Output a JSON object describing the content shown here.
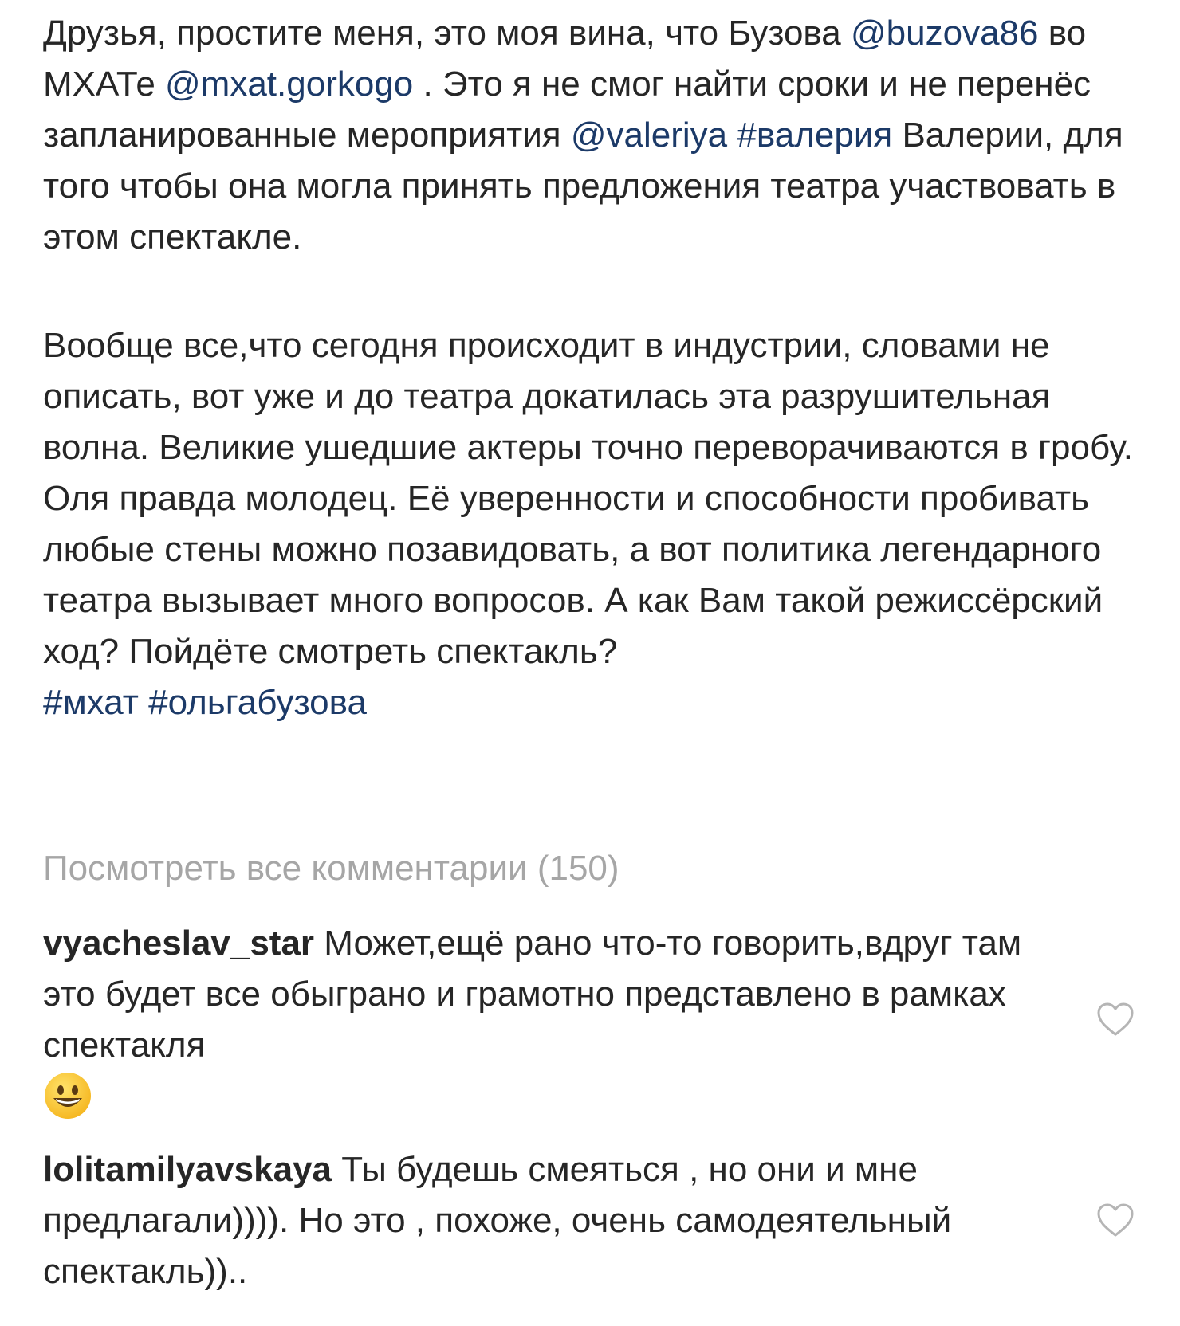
{
  "caption": {
    "clipped_top_line": "…",
    "para1": {
      "t1": "Друзья, простите меня, это моя вина, что Бузова ",
      "mention1": "@buzova86",
      "t2": " во МХАТе ",
      "mention2": "@mxat.gorkogo",
      "t3": " . Это я не смог найти сроки и не перенёс запланированные мероприятия ",
      "mention3": "@valeriya",
      "t4": " ",
      "hashtag1": "#валерия",
      "t5": " Валерии, для того чтобы она могла  принять предложения театра участвовать в этом спектакле."
    },
    "para2": {
      "text": "Вообще все,что сегодня происходит в индустрии, словами не описать, вот уже и до театра докатилась эта разрушительная волна. Великие ушедшие актеры точно переворачиваются в гробу. Оля правда молодец. Её уверенности и способности пробивать любые стены можно позавидовать, а вот политика легендарного театра вызывает много вопросов. А как Вам такой режиссёрский ход? Пойдёте смотреть спектакль?",
      "hashtag1": "#мхат",
      "hashtag2": "#ольгабузова"
    }
  },
  "view_all_comments": "Посмотреть все комментарии (150)",
  "comments": [
    {
      "username": "vyacheslav_star",
      "text": "Может,ещё рано что-то говорить,вдруг там это будет все обыграно и грамотно представлено в рамках спектакля",
      "emoji": "grinning-face-emoji",
      "like_icon": "heart-outline-icon"
    },
    {
      "username": "lolitamilyavskaya",
      "text": "Ты будешь смеяться , но они и мне предлагали)))). Но это , похоже, очень самодеятельный спектакль))..",
      "like_icon": "heart-outline-icon"
    }
  ],
  "colors": {
    "text": "#262626",
    "link": "#1c3a68",
    "muted": "#a6a6a6",
    "background": "#ffffff"
  }
}
